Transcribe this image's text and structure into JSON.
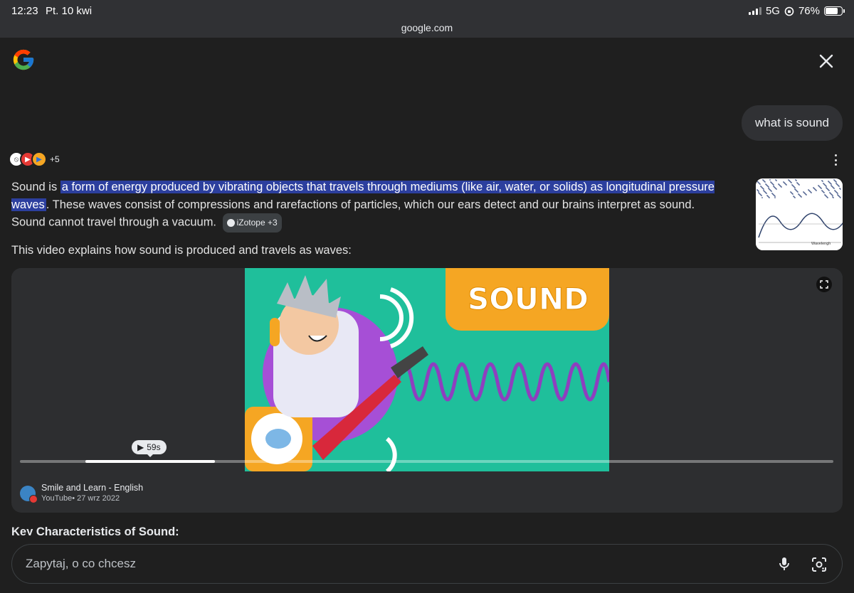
{
  "status_bar": {
    "time": "12:23",
    "date": "Pt. 10 kwi",
    "url": "google.com",
    "network": "5G",
    "battery": "76%",
    "battery_level": 0.76
  },
  "query": "what is sound",
  "sources": {
    "more_count": "+5"
  },
  "answer": {
    "intro": "Sound is ",
    "highlight": "a form of energy produced by vibrating objects that travels through mediums (like air, water, or solids) as longitudinal pressure waves",
    "rest": ". These waves consist of compressions and rarefactions of particles, which our ears detect and our brains interpret as sound. Sound cannot travel through a vacuum.",
    "citation": "iZotope +3"
  },
  "thumbnail": {
    "label": "Wavelengh"
  },
  "video_intro": "This video explains how sound is produced and travels as waves:",
  "video": {
    "title_text": "SOUND",
    "duration": "59s",
    "progress": 0.24,
    "channel": "Smile and Learn - English",
    "meta": "YouTube• 27 wrz 2022"
  },
  "section_heading": "Key Characteristics of Sound:",
  "ask": {
    "placeholder": "Zapytaj, o co chcesz"
  },
  "colors": {
    "background": "#1f1f1f",
    "highlight": "#2c3f9e",
    "video_teal": "#1fbf9b",
    "video_orange": "#f5a623",
    "video_purple": "#a64fd6"
  }
}
